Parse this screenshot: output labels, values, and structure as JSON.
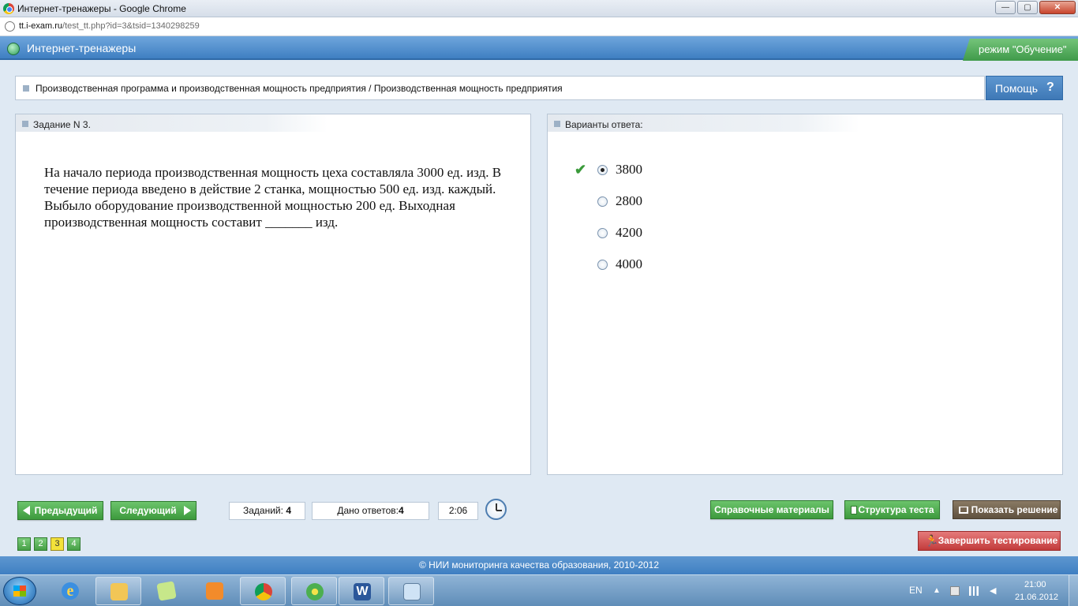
{
  "browser": {
    "window_title": "Интернет-тренажеры - Google Chrome",
    "url_host": "tt.i-exam.ru",
    "url_path": "/test_tt.php?id=3&tsid=1340298259"
  },
  "header": {
    "app_title": "Интернет-тренажеры",
    "mode": "режим \"Обучение\""
  },
  "breadcrumb": {
    "text": "Производственная программа и производственная мощность предприятия / Производственная мощность предприятия",
    "help_label": "Помощь",
    "help_glyph": "?"
  },
  "task": {
    "heading": "Задание N 3.",
    "text": "На начало периода производственная мощность цеха составляла 3000 ед. изд. В течение периода введено в действие 2 станка, мощностью 500 ед. изд. каждый. Выбыло оборудование производственной мощностью 200 ед. Выходная производственная мощность составит _______ изд."
  },
  "answers": {
    "heading": "Варианты ответа:",
    "options": [
      {
        "label": "3800",
        "selected": true,
        "correct_mark": true
      },
      {
        "label": "2800",
        "selected": false,
        "correct_mark": false
      },
      {
        "label": "4200",
        "selected": false,
        "correct_mark": false
      },
      {
        "label": "4000",
        "selected": false,
        "correct_mark": false
      }
    ],
    "check_glyph": "✔"
  },
  "toolbar": {
    "prev_label": "Предыдущий",
    "next_label": "Следующий",
    "tasks_label": "Заданий:",
    "tasks_value": "4",
    "answered_label": "Дано ответов:",
    "answered_value": "4",
    "timer": "2:06",
    "reference_label": "Справочные материалы",
    "structure_label": "Структура теста",
    "solution_label": "Показать решение",
    "finish_label": "Завершить тестирование",
    "pages": [
      "1",
      "2",
      "3",
      "4"
    ],
    "current_page": "3"
  },
  "footer": {
    "copyright": "© НИИ мониторинга качества образования, 2010-2012"
  },
  "taskbar": {
    "lang": "EN",
    "time": "21:00",
    "date": "21.06.2012",
    "ie_glyph": "e",
    "word_glyph": "W"
  },
  "colors": {
    "accent_blue": "#3f7fc2",
    "button_green": "#46a046",
    "finish_red": "#c23b3b",
    "solution_brown": "#5f513f",
    "mode_green": "#3f9a4a"
  }
}
